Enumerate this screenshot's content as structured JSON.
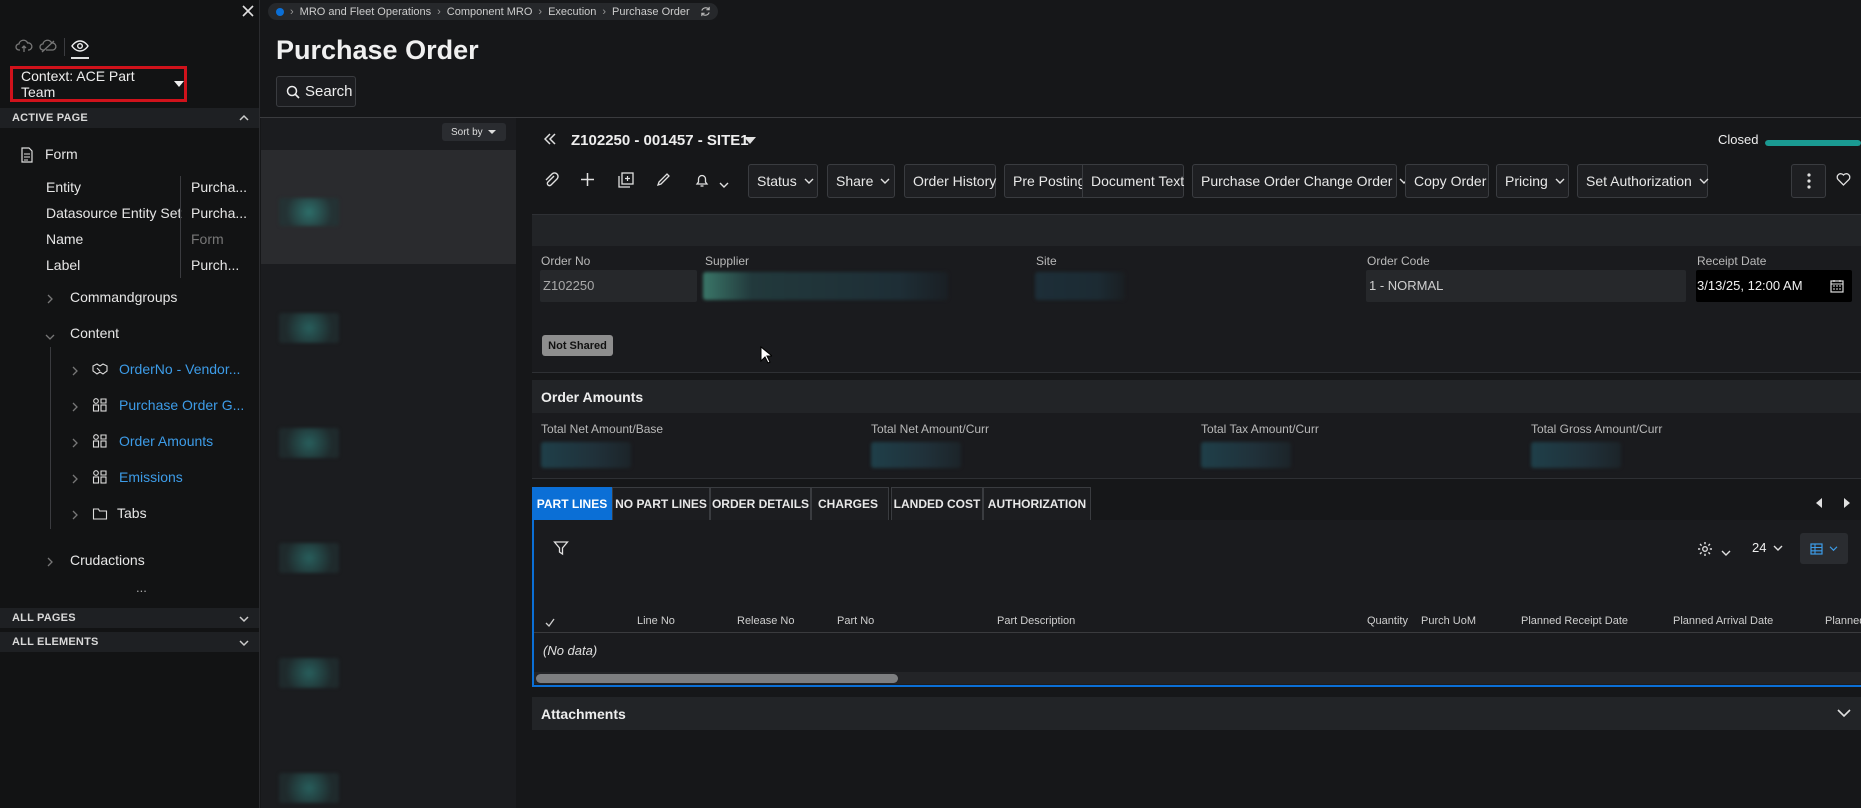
{
  "breadcrumb": {
    "items": [
      "MRO and Fleet Operations",
      "Component MRO",
      "Execution",
      "Purchase Order"
    ]
  },
  "page": {
    "title": "Purchase Order",
    "search_label": "Search",
    "sort_label": "Sort by"
  },
  "dev_panel": {
    "context_label": "Context: ACE Part Team",
    "active_page_label": "ACTIVE PAGE",
    "form_label": "Form",
    "properties": [
      {
        "key": "Entity",
        "value": "Purcha..."
      },
      {
        "key": "Datasource Entity Set",
        "value": "Purcha..."
      },
      {
        "key": "Name",
        "value": "Form"
      },
      {
        "key": "Label",
        "value": "Purch..."
      }
    ],
    "tree": {
      "commandgroups": "Commandgroups",
      "content": "Content",
      "content_items": [
        "OrderNo - Vendor...",
        "Purchase Order G...",
        "Order Amounts",
        "Emissions"
      ],
      "tabs": "Tabs",
      "crudactions": "Crudactions",
      "ellipsis": "..."
    },
    "all_pages_label": "ALL PAGES",
    "all_elements_label": "ALL ELEMENTS"
  },
  "record": {
    "title": "Z102250 - 001457 - SITE1",
    "status": "Closed",
    "progress": 1.0
  },
  "toolbar": {
    "status": "Status",
    "share": "Share",
    "order_history": "Order History",
    "pre_posting": "Pre Posting",
    "document_text": "Document Text",
    "po_change_order": "Purchase Order Change Order",
    "copy_order": "Copy Order",
    "pricing": "Pricing",
    "set_authorization": "Set Authorization"
  },
  "header_fields": {
    "order_no_label": "Order No",
    "order_no_value": "Z102250",
    "supplier_label": "Supplier",
    "site_label": "Site",
    "order_code_label": "Order Code",
    "order_code_value": "1 - NORMAL",
    "receipt_date_label": "Receipt Date",
    "receipt_date_value": "3/13/25, 12:00 AM",
    "not_shared_badge": "Not Shared"
  },
  "order_amounts": {
    "title": "Order Amounts",
    "labels": [
      "Total Net Amount/Base",
      "Total Net Amount/Curr",
      "Total Tax Amount/Curr",
      "Total Gross Amount/Curr"
    ]
  },
  "tabs": [
    "PART LINES",
    "NO PART LINES",
    "ORDER DETAILS",
    "CHARGES",
    "LANDED COST",
    "AUTHORIZATION"
  ],
  "grid": {
    "page_size": "24",
    "columns": [
      "Line No",
      "Release No",
      "Part No",
      "Part Description",
      "Quantity",
      "Purch UoM",
      "Planned Receipt Date",
      "Planned Arrival Date",
      "Planned"
    ],
    "empty_text": "(No data)"
  },
  "attachments": {
    "title": "Attachments"
  },
  "colors": {
    "accent_blue": "#0b6fd6",
    "link_blue": "#3d9ce8",
    "highlight_red": "#d0121b",
    "progress_teal": "#1a9a92"
  }
}
